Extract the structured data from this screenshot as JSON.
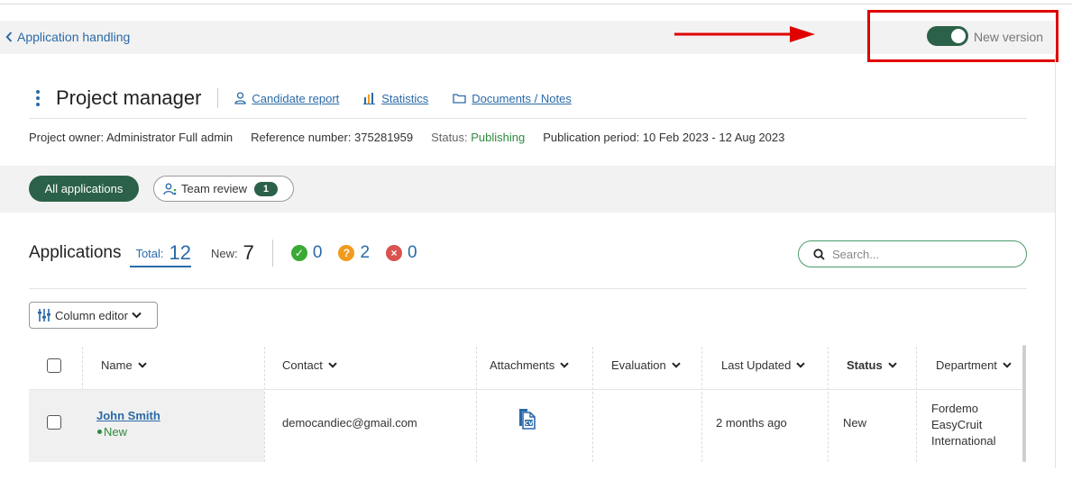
{
  "nav": {
    "back_label": "Application handling"
  },
  "version": {
    "label": "New version",
    "enabled": true,
    "accent": "#2b6148",
    "highlight_color": "#e00000"
  },
  "header": {
    "title": "Project manager",
    "links": [
      {
        "label": "Candidate report",
        "icon": "person-icon"
      },
      {
        "label": "Statistics",
        "icon": "bar-chart-icon"
      },
      {
        "label": "Documents / Notes",
        "icon": "folder-icon"
      }
    ]
  },
  "meta": {
    "owner": "Project owner: Administrator Full admin",
    "reference": "Reference number: 375281959",
    "status_label": "Status:",
    "status_value": "Publishing",
    "period": "Publication period: 10 Feb 2023 - 12 Aug 2023"
  },
  "filters": {
    "all_label": "All applications",
    "team_label": "Team review",
    "team_count": "1"
  },
  "applications": {
    "title": "Applications",
    "total_label": "Total:",
    "total_value": "12",
    "new_label": "New:",
    "new_value": "7",
    "approved": "0",
    "pending": "2",
    "rejected": "0",
    "colors": {
      "approved": "#3aaa35",
      "pending": "#f39a1d",
      "rejected": "#d9534f"
    }
  },
  "search": {
    "placeholder": "Search..."
  },
  "column_editor": {
    "label": "Column editor"
  },
  "table": {
    "columns": [
      "Name",
      "Contact",
      "Attachments",
      "Evaluation",
      "Last Updated",
      "Status",
      "Department"
    ],
    "rows": [
      {
        "name": "John Smith",
        "sub_status": "New",
        "contact": "democandiec@gmail.com",
        "attachment": "cv-icon",
        "evaluation": "",
        "last_updated": "2 months ago",
        "status": "New",
        "department": "Fordemo EasyCruit International"
      }
    ]
  }
}
